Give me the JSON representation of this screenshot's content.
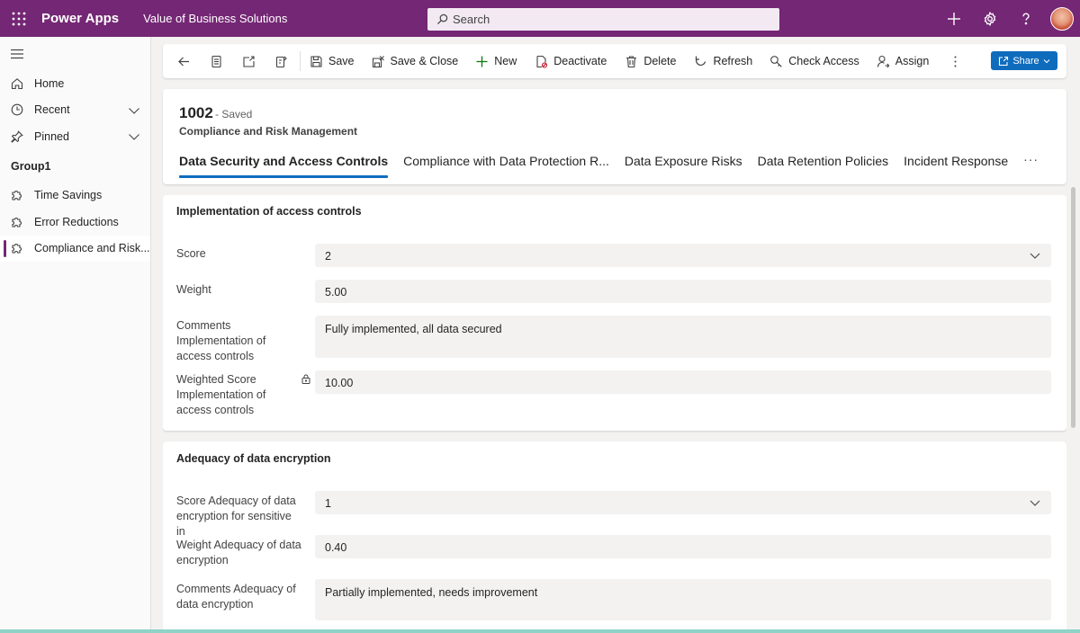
{
  "topbar": {
    "app_name": "Power Apps",
    "env_name": "Value of Business Solutions",
    "search_placeholder": "Search",
    "icons": [
      "waffle-icon",
      "search-icon",
      "add-icon",
      "settings-icon",
      "help-icon",
      "avatar"
    ]
  },
  "sidebar": {
    "items": [
      {
        "label": "Home",
        "icon": "home-icon"
      },
      {
        "label": "Recent",
        "icon": "clock-icon"
      },
      {
        "label": "Pinned",
        "icon": "pin-icon"
      }
    ],
    "group_label": "Group1",
    "group_items": [
      {
        "label": "Time Savings",
        "icon": "puzzle-icon"
      },
      {
        "label": "Error Reductions",
        "icon": "puzzle-icon"
      },
      {
        "label": "Compliance and Risk...",
        "icon": "puzzle-icon",
        "active": true
      }
    ]
  },
  "commandbar": {
    "save": "Save",
    "save_close": "Save & Close",
    "new": "New",
    "deactivate": "Deactivate",
    "delete": "Delete",
    "refresh": "Refresh",
    "check_access": "Check Access",
    "assign": "Assign",
    "share": "Share"
  },
  "record": {
    "title": "1002",
    "status": "- Saved",
    "entity": "Compliance and Risk Management",
    "tabs": [
      "Data Security and Access Controls",
      "Compliance with Data Protection R...",
      "Data Exposure Risks",
      "Data Retention Policies",
      "Incident Response"
    ],
    "more": "···"
  },
  "sections": {
    "s1": {
      "title": "Implementation of access controls",
      "score_label": "Score",
      "score_value": "2",
      "weight_label": "Weight",
      "weight_value": "5.00",
      "comments_label": "Comments Implementation of access controls",
      "comments_value": "Fully implemented, all data secured",
      "weighted_label": "Weighted Score Implementation of access controls",
      "weighted_value": "10.00"
    },
    "s2": {
      "title": "Adequacy of data encryption",
      "score_label": "Score Adequacy of data encryption for sensitive in",
      "score_value": "1",
      "weight_label": "Weight Adequacy of data encryption",
      "weight_value": "0.40",
      "comments_label": "Comments Adequacy of data encryption",
      "comments_value": "Partially implemented, needs improvement"
    }
  },
  "colors": {
    "brand": "#742774",
    "accent": "#0f6cbd"
  }
}
